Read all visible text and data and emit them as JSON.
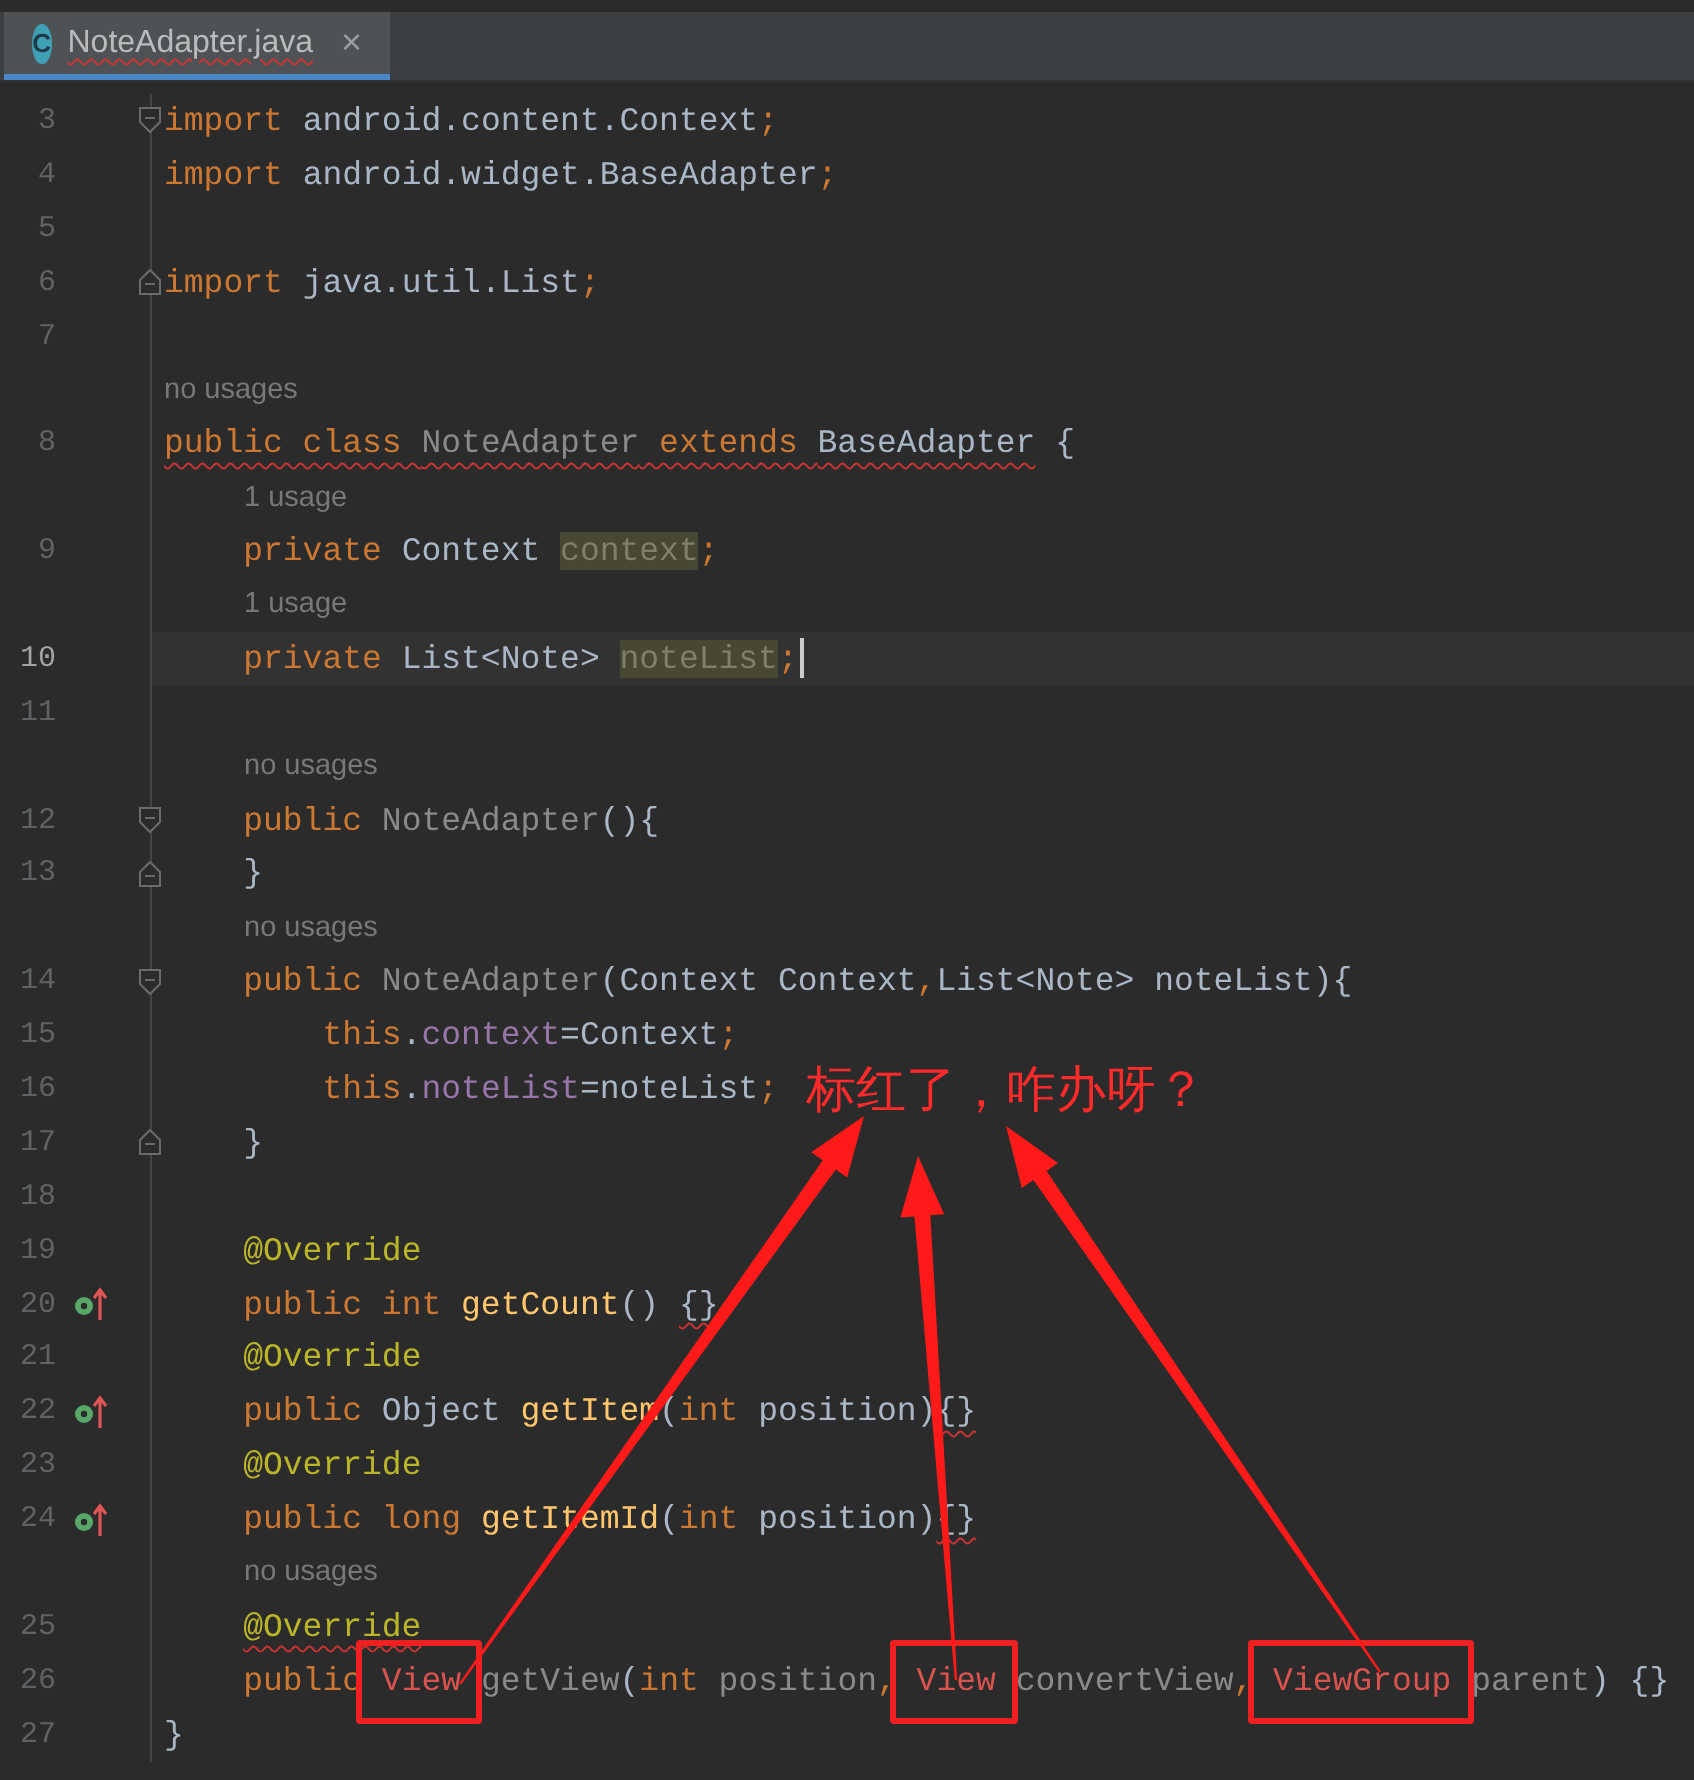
{
  "tab": {
    "icon_letter": "C",
    "title": "NoteAdapter.java",
    "close": "×",
    "selected": true,
    "error": true
  },
  "rows": [
    {
      "kind": "code",
      "number": "3",
      "fold_start": true,
      "tokens": [
        {
          "text": "import",
          "kind": "keyword"
        },
        {
          "text": " android.content.Context",
          "kind": "plain"
        },
        {
          "text": ";",
          "kind": "keyword"
        }
      ]
    },
    {
      "kind": "code",
      "number": "4",
      "tokens": [
        {
          "text": "import",
          "kind": "keyword"
        },
        {
          "text": " android.widget.BaseAdapter",
          "kind": "plain"
        },
        {
          "text": ";",
          "kind": "keyword"
        }
      ]
    },
    {
      "kind": "code",
      "number": "5",
      "tokens": []
    },
    {
      "kind": "code",
      "number": "6",
      "fold_end": true,
      "tokens": [
        {
          "text": "import",
          "kind": "keyword"
        },
        {
          "text": " java.util.List",
          "kind": "plain"
        },
        {
          "text": ";",
          "kind": "keyword"
        }
      ]
    },
    {
      "kind": "code",
      "number": "7",
      "tokens": []
    },
    {
      "kind": "hint",
      "nested": false,
      "text": "no usages"
    },
    {
      "kind": "code",
      "number": "8",
      "tokens": [
        {
          "text": "public class ",
          "kind": "keyword",
          "squiggle": true
        },
        {
          "text": "NoteAdapter",
          "kind": "unused",
          "squiggle": true
        },
        {
          "text": " extends ",
          "kind": "keyword",
          "squiggle": true
        },
        {
          "text": "BaseAdapter",
          "kind": "plain",
          "squiggle": true
        },
        {
          "text": " {",
          "kind": "plain"
        }
      ]
    },
    {
      "kind": "hint",
      "nested": true,
      "text": "1 usage"
    },
    {
      "kind": "code",
      "number": "9",
      "tokens": [
        {
          "text": "    private ",
          "kind": "keyword"
        },
        {
          "text": "Context ",
          "kind": "plain"
        },
        {
          "text": "context",
          "kind": "unused-field"
        },
        {
          "text": ";",
          "kind": "keyword"
        }
      ]
    },
    {
      "kind": "hint",
      "nested": true,
      "text": "1 usage"
    },
    {
      "kind": "code",
      "number": "10",
      "current": true,
      "caret": true,
      "tokens": [
        {
          "text": "    private ",
          "kind": "keyword"
        },
        {
          "text": "List<Note> ",
          "kind": "plain"
        },
        {
          "text": "noteList",
          "kind": "unused-field"
        },
        {
          "text": ";",
          "kind": "keyword"
        }
      ]
    },
    {
      "kind": "code",
      "number": "11",
      "tokens": []
    },
    {
      "kind": "hint",
      "nested": true,
      "text": "no usages"
    },
    {
      "kind": "code",
      "number": "12",
      "fold_start": true,
      "tokens": [
        {
          "text": "    public ",
          "kind": "keyword"
        },
        {
          "text": "NoteAdapter",
          "kind": "unused"
        },
        {
          "text": "(){",
          "kind": "plain"
        }
      ]
    },
    {
      "kind": "code",
      "number": "13",
      "fold_end": true,
      "tokens": [
        {
          "text": "    }",
          "kind": "plain"
        }
      ]
    },
    {
      "kind": "hint",
      "nested": true,
      "text": "no usages"
    },
    {
      "kind": "code",
      "number": "14",
      "fold_start": true,
      "tokens": [
        {
          "text": "    public ",
          "kind": "keyword"
        },
        {
          "text": "NoteAdapter",
          "kind": "unused"
        },
        {
          "text": "(Context Context",
          "kind": "plain"
        },
        {
          "text": ",",
          "kind": "keyword"
        },
        {
          "text": "List<Note> noteList){",
          "kind": "plain"
        }
      ]
    },
    {
      "kind": "code",
      "number": "15",
      "tokens": [
        {
          "text": "        this",
          "kind": "keyword"
        },
        {
          "text": ".",
          "kind": "plain"
        },
        {
          "text": "context",
          "kind": "field"
        },
        {
          "text": "=Context",
          "kind": "plain"
        },
        {
          "text": ";",
          "kind": "keyword"
        }
      ]
    },
    {
      "kind": "code",
      "number": "16",
      "tokens": [
        {
          "text": "        this",
          "kind": "keyword"
        },
        {
          "text": ".",
          "kind": "plain"
        },
        {
          "text": "noteList",
          "kind": "field"
        },
        {
          "text": "=noteList",
          "kind": "plain"
        },
        {
          "text": ";",
          "kind": "keyword"
        }
      ]
    },
    {
      "kind": "code",
      "number": "17",
      "fold_end": true,
      "tokens": [
        {
          "text": "    }",
          "kind": "plain"
        }
      ]
    },
    {
      "kind": "code",
      "number": "18",
      "tokens": []
    },
    {
      "kind": "code",
      "number": "19",
      "tokens": [
        {
          "text": "    @Override",
          "kind": "annotation"
        }
      ]
    },
    {
      "kind": "code",
      "number": "20",
      "override": true,
      "tokens": [
        {
          "text": "    public int ",
          "kind": "keyword"
        },
        {
          "text": "getCount",
          "kind": "method"
        },
        {
          "text": "() ",
          "kind": "plain"
        },
        {
          "text": "{}",
          "kind": "plain",
          "squiggle": true
        }
      ]
    },
    {
      "kind": "code",
      "number": "21",
      "tokens": [
        {
          "text": "    @Override",
          "kind": "annotation"
        }
      ]
    },
    {
      "kind": "code",
      "number": "22",
      "override": true,
      "tokens": [
        {
          "text": "    public ",
          "kind": "keyword"
        },
        {
          "text": "Object ",
          "kind": "plain"
        },
        {
          "text": "getItem",
          "kind": "method"
        },
        {
          "text": "(",
          "kind": "plain"
        },
        {
          "text": "int ",
          "kind": "keyword"
        },
        {
          "text": "position)",
          "kind": "plain"
        },
        {
          "text": "{}",
          "kind": "plain",
          "squiggle": true
        }
      ]
    },
    {
      "kind": "code",
      "number": "23",
      "tokens": [
        {
          "text": "    @Override",
          "kind": "annotation"
        }
      ]
    },
    {
      "kind": "code",
      "number": "24",
      "override": true,
      "tokens": [
        {
          "text": "    public long ",
          "kind": "keyword"
        },
        {
          "text": "getItemId",
          "kind": "method"
        },
        {
          "text": "(",
          "kind": "plain"
        },
        {
          "text": "int ",
          "kind": "keyword"
        },
        {
          "text": "position)",
          "kind": "plain"
        },
        {
          "text": "{}",
          "kind": "plain",
          "squiggle": true
        }
      ]
    },
    {
      "kind": "hint",
      "nested": true,
      "text": "no usages"
    },
    {
      "kind": "code",
      "number": "25",
      "nested": true,
      "tokens": [
        {
          "text": "@Override",
          "kind": "annotation",
          "squiggle": true
        }
      ]
    },
    {
      "kind": "code",
      "number": "26",
      "tokens": [
        {
          "text": "    public",
          "kind": "keyword"
        },
        {
          "text": " View ",
          "kind": "error",
          "boxed": true
        },
        {
          "text": "getView",
          "kind": "unused"
        },
        {
          "text": "(",
          "kind": "plain"
        },
        {
          "text": "int ",
          "kind": "keyword"
        },
        {
          "text": "position",
          "kind": "unused"
        },
        {
          "text": ",",
          "kind": "keyword"
        },
        {
          "text": " View ",
          "kind": "error",
          "boxed": true
        },
        {
          "text": "convertView",
          "kind": "unused"
        },
        {
          "text": ",",
          "kind": "keyword"
        },
        {
          "text": " ViewGroup ",
          "kind": "error",
          "boxed": true
        },
        {
          "text": "parent",
          "kind": "unused"
        },
        {
          "text": ") {}",
          "kind": "plain"
        }
      ]
    },
    {
      "kind": "code",
      "number": "27",
      "tokens": [
        {
          "text": "}",
          "kind": "plain"
        }
      ]
    }
  ],
  "callout": {
    "text": "标红了，咋办呀？"
  }
}
